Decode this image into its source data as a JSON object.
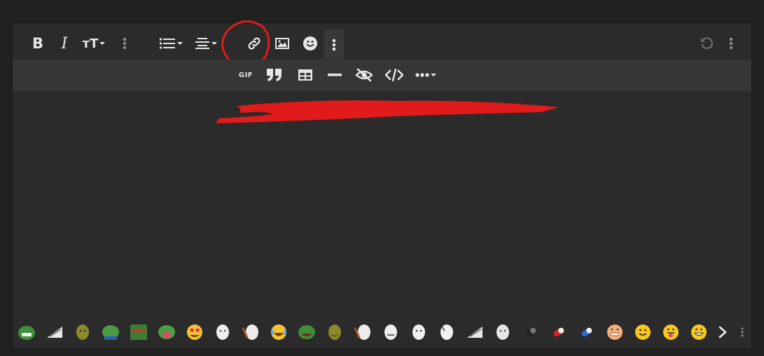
{
  "toolbar": {
    "bold": "B",
    "italic": "I",
    "text_size": "тT",
    "gif": "GIF",
    "quote": "99"
  },
  "icons": [
    "bold-icon",
    "italic-icon",
    "text-size-icon",
    "more-vertical-icon",
    "list-icon",
    "align-icon",
    "link-icon",
    "image-icon",
    "smiley-icon",
    "gif-icon",
    "quote-icon",
    "table-icon",
    "horizontal-rule-icon",
    "spoiler-icon",
    "code-icon",
    "more-horizontal-icon",
    "undo-icon"
  ],
  "emoji_count": 25,
  "colors": {
    "page_bg": "#212121",
    "editor_bg": "#2b2b2b",
    "toolbar2_bg": "#363636",
    "icon": "#e6e6e6",
    "annotation_red": "#e11b1b"
  }
}
